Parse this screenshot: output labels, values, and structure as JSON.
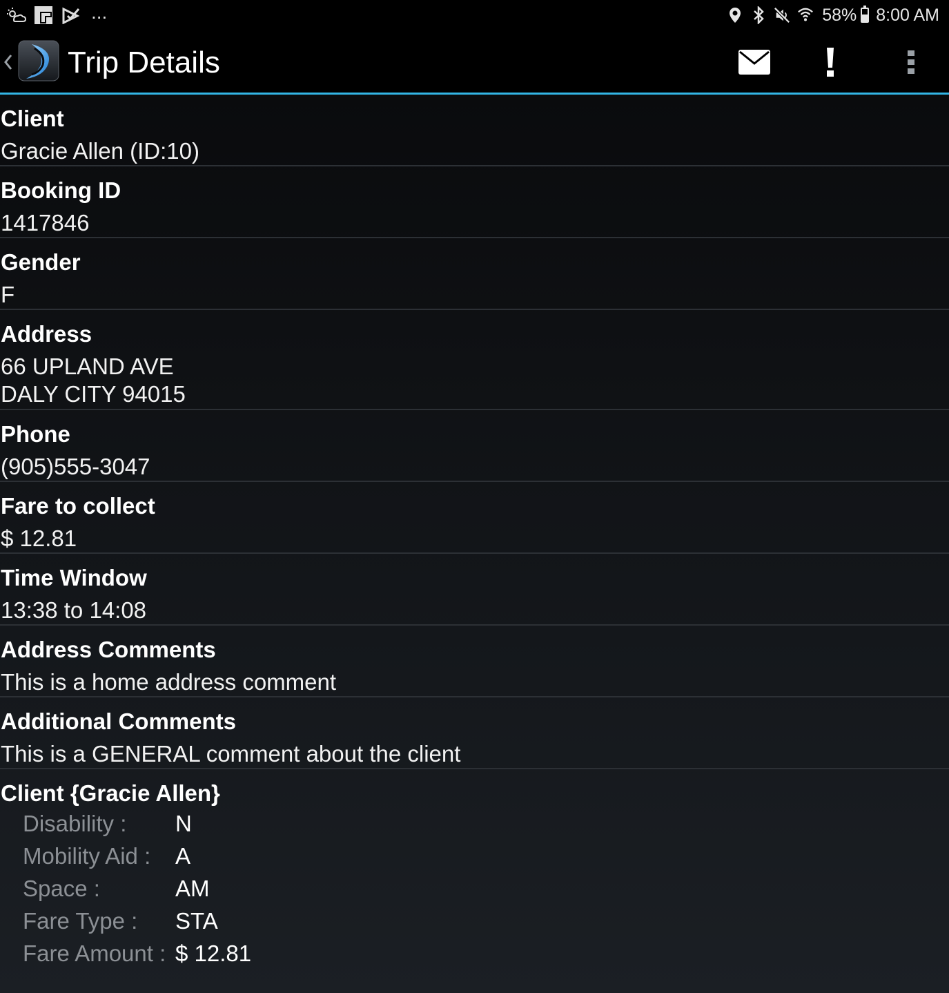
{
  "status_bar": {
    "left_icons": [
      "weather-icon",
      "flipboard-icon",
      "checkmark-app-icon"
    ],
    "overflow_text": "...",
    "right_icons": [
      "location-icon",
      "bluetooth-icon",
      "mute-icon",
      "wifi-icon"
    ],
    "battery_text": "58%",
    "battery_level": 0.58,
    "time": "8:00 AM"
  },
  "action_bar": {
    "title": "Trip Details",
    "accent_color": "#33b5e5",
    "actions": [
      "mail-icon",
      "alert-icon",
      "overflow-menu-icon"
    ]
  },
  "details": {
    "client": {
      "label": "Client",
      "value": "Gracie Allen (ID:10)"
    },
    "booking_id": {
      "label": "Booking ID",
      "value": "1417846"
    },
    "gender": {
      "label": "Gender",
      "value": "F"
    },
    "address": {
      "label": "Address",
      "line1": "66 UPLAND AVE",
      "line2": "DALY CITY 94015"
    },
    "phone": {
      "label": "Phone",
      "value": "(905)555-3047"
    },
    "fare_to_collect": {
      "label": "Fare to collect",
      "value": "$ 12.81"
    },
    "time_window": {
      "label": "Time Window",
      "value": "13:38 to 14:08"
    },
    "address_comments": {
      "label": "Address Comments",
      "value": "This is a home address comment"
    },
    "additional_comments": {
      "label": "Additional Comments",
      "value": "This is a GENERAL comment about the client"
    }
  },
  "client_summary": {
    "title": "Client {Gracie Allen}",
    "fields": [
      {
        "key": "Disability :",
        "value": "N"
      },
      {
        "key": "Mobility Aid :",
        "value": "A"
      },
      {
        "key": "Space :",
        "value": "AM"
      },
      {
        "key": "Fare Type :",
        "value": "STA"
      },
      {
        "key": "Fare Amount :",
        "value": "$ 12.81"
      }
    ]
  }
}
